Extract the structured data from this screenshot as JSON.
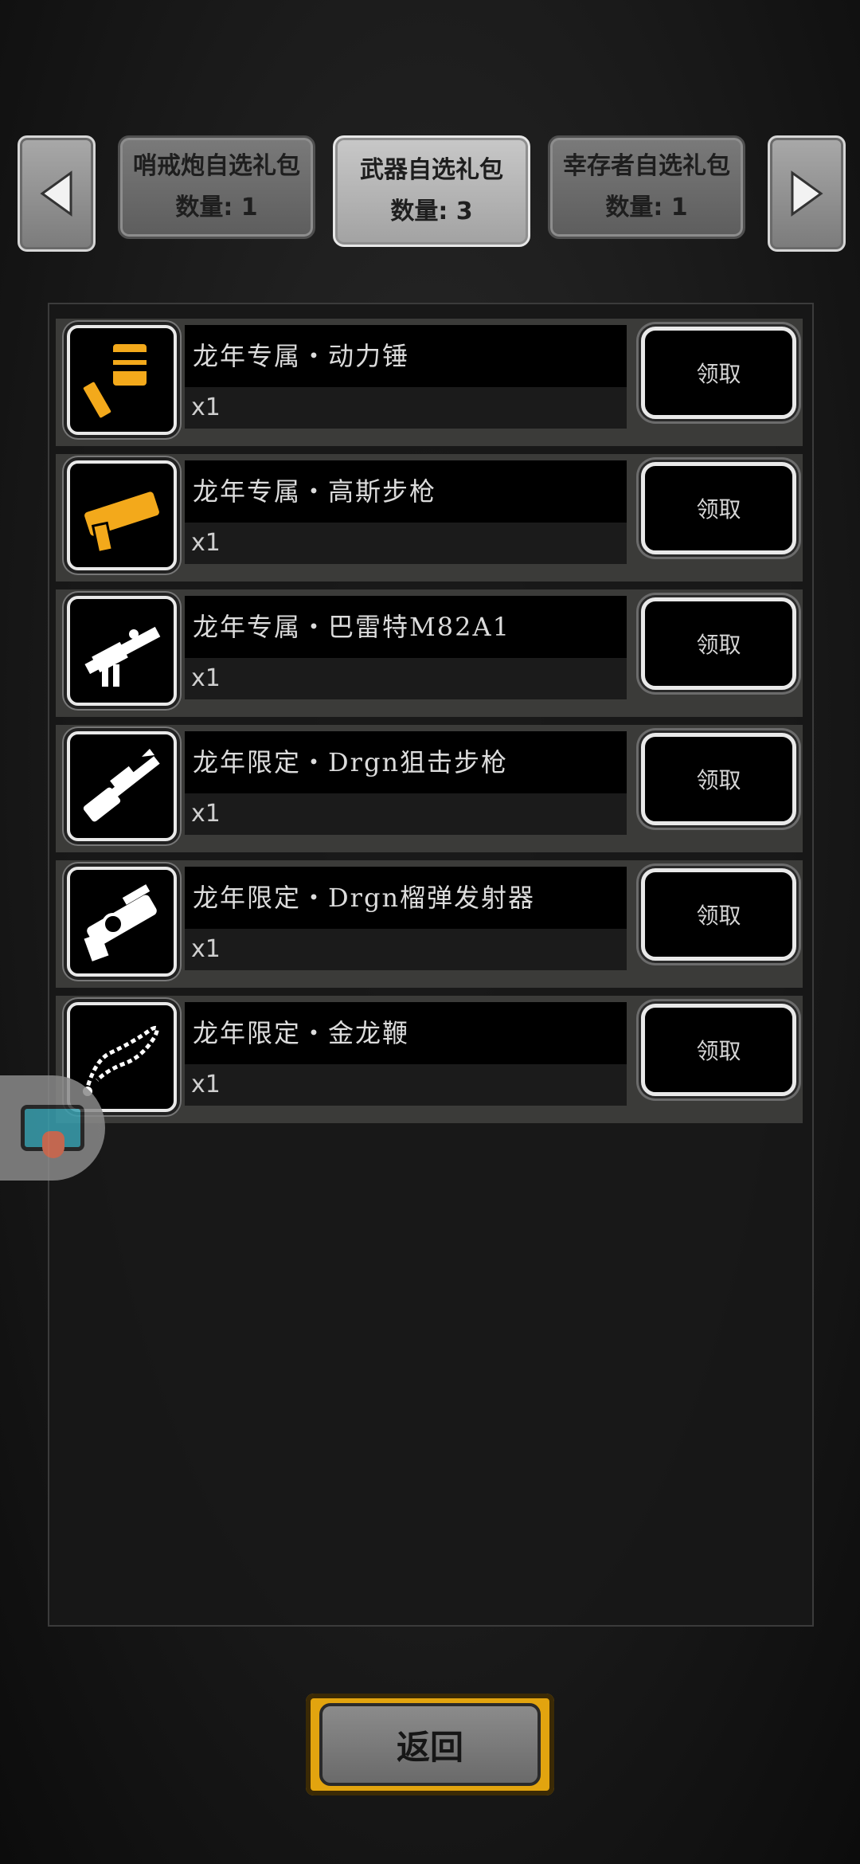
{
  "tabs": [
    {
      "title": "哨戒炮自选礼包",
      "count": "数量: 1"
    },
    {
      "title": "武器自选礼包",
      "count": "数量: 3"
    },
    {
      "title": "幸存者自选礼包",
      "count": "数量: 1"
    }
  ],
  "items": [
    {
      "name": "龙年专属・动力锤",
      "qty": "x1",
      "claim": "领取",
      "icon": "power-hammer-icon",
      "color": "#f3a91b"
    },
    {
      "name": "龙年专属・高斯步枪",
      "qty": "x1",
      "claim": "领取",
      "icon": "gauss-rifle-icon",
      "color": "#f3a91b"
    },
    {
      "name": "龙年专属・巴雷特M82A1",
      "qty": "x1",
      "claim": "领取",
      "icon": "barrett-rifle-icon",
      "color": "#ffffff"
    },
    {
      "name": "龙年限定・Drgn狙击步枪",
      "qty": "x1",
      "claim": "领取",
      "icon": "sniper-rifle-icon",
      "color": "#ffffff"
    },
    {
      "name": "龙年限定・Drgn榴弹发射器",
      "qty": "x1",
      "claim": "领取",
      "icon": "grenade-launcher-icon",
      "color": "#ffffff"
    },
    {
      "name": "龙年限定・金龙鞭",
      "qty": "x1",
      "claim": "领取",
      "icon": "dragon-whip-icon",
      "color": "#ffffff"
    }
  ],
  "return_label": "返回"
}
